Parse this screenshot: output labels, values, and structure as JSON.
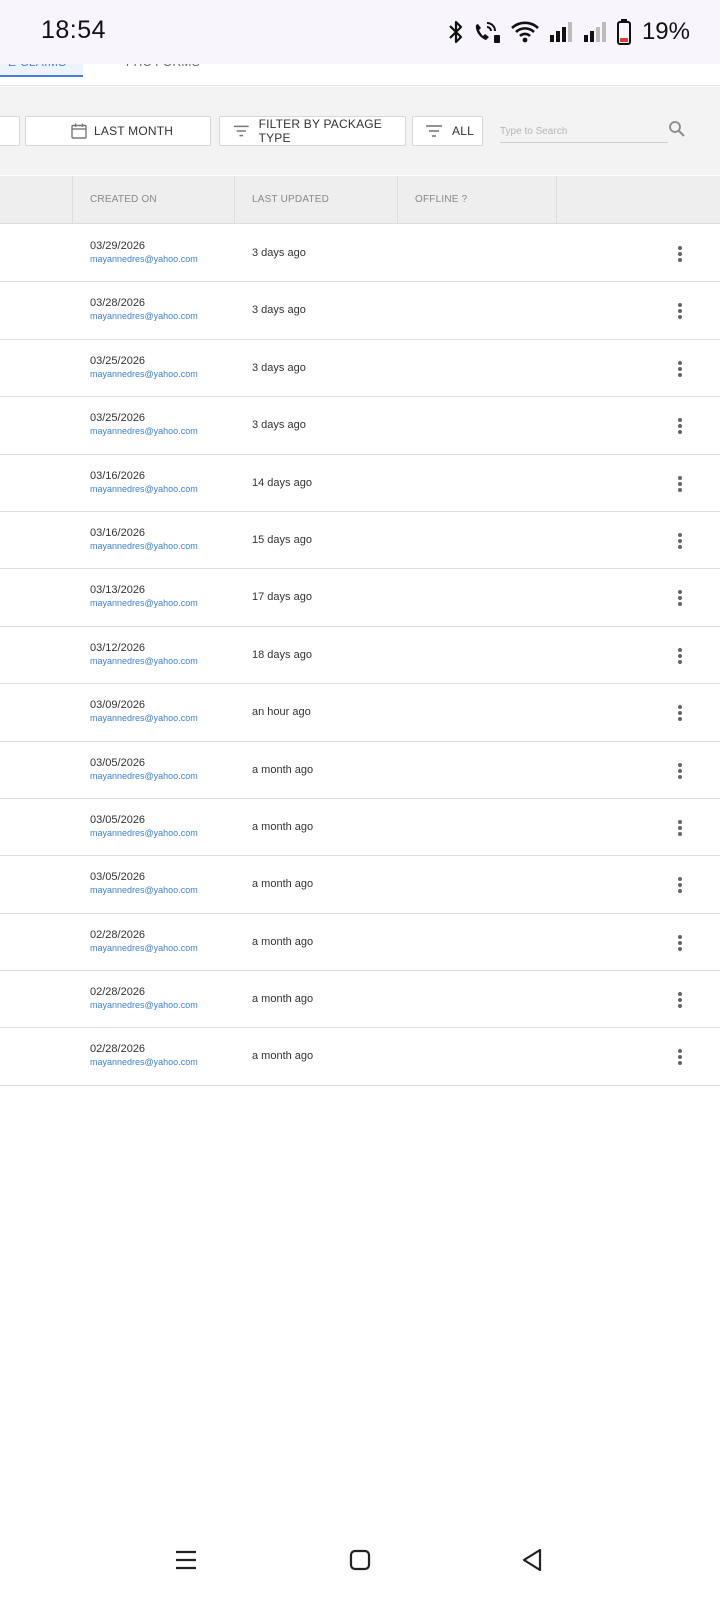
{
  "status_bar": {
    "time": "18:54",
    "battery_percent": "19%",
    "icons": [
      "bluetooth-icon",
      "wifi-calling-icon",
      "wifi-icon",
      "signal-icon",
      "signal-icon",
      "battery-icon"
    ]
  },
  "tabs": [
    {
      "label": "E CLAIMS",
      "active": true
    },
    {
      "label": "FHC FORMS",
      "active": false
    }
  ],
  "filters": {
    "date_range": "LAST MONTH",
    "package_type": "FILTER BY PACKAGE TYPE",
    "status": "ALL",
    "search_placeholder": "Type to Search"
  },
  "table": {
    "columns": [
      "CREATED ON",
      "LAST UPDATED",
      "OFFLINE ?"
    ],
    "rows": [
      {
        "created_on": "03/29/2026",
        "created_by": "mayannedres@yahoo.com",
        "last_updated": "3 days ago"
      },
      {
        "created_on": "03/28/2026",
        "created_by": "mayannedres@yahoo.com",
        "last_updated": "3 days ago"
      },
      {
        "created_on": "03/25/2026",
        "created_by": "mayannedres@yahoo.com",
        "last_updated": "3 days ago"
      },
      {
        "created_on": "03/25/2026",
        "created_by": "mayannedres@yahoo.com",
        "last_updated": "3 days ago"
      },
      {
        "created_on": "03/16/2026",
        "created_by": "mayannedres@yahoo.com",
        "last_updated": "14 days ago"
      },
      {
        "created_on": "03/16/2026",
        "created_by": "mayannedres@yahoo.com",
        "last_updated": "15 days ago"
      },
      {
        "created_on": "03/13/2026",
        "created_by": "mayannedres@yahoo.com",
        "last_updated": "17 days ago"
      },
      {
        "created_on": "03/12/2026",
        "created_by": "mayannedres@yahoo.com",
        "last_updated": "18 days ago"
      },
      {
        "created_on": "03/09/2026",
        "created_by": "mayannedres@yahoo.com",
        "last_updated": "an hour ago"
      },
      {
        "created_on": "03/05/2026",
        "created_by": "mayannedres@yahoo.com",
        "last_updated": "a month ago"
      },
      {
        "created_on": "03/05/2026",
        "created_by": "mayannedres@yahoo.com",
        "last_updated": "a month ago"
      },
      {
        "created_on": "03/05/2026",
        "created_by": "mayannedres@yahoo.com",
        "last_updated": "a month ago"
      },
      {
        "created_on": "02/28/2026",
        "created_by": "mayannedres@yahoo.com",
        "last_updated": "a month ago"
      },
      {
        "created_on": "02/28/2026",
        "created_by": "mayannedres@yahoo.com",
        "last_updated": "a month ago"
      },
      {
        "created_on": "02/28/2026",
        "created_by": "mayannedres@yahoo.com",
        "last_updated": "a month ago"
      }
    ]
  },
  "nav_bar": {
    "buttons": [
      "menu-icon",
      "home-icon",
      "back-icon"
    ]
  },
  "colors": {
    "accent": "#4a80d4",
    "email_link": "#3f80cf",
    "status_bar_bg": "#f8f5fc",
    "filter_bg": "#f3f3f3",
    "header_bg": "#eeeeee"
  }
}
